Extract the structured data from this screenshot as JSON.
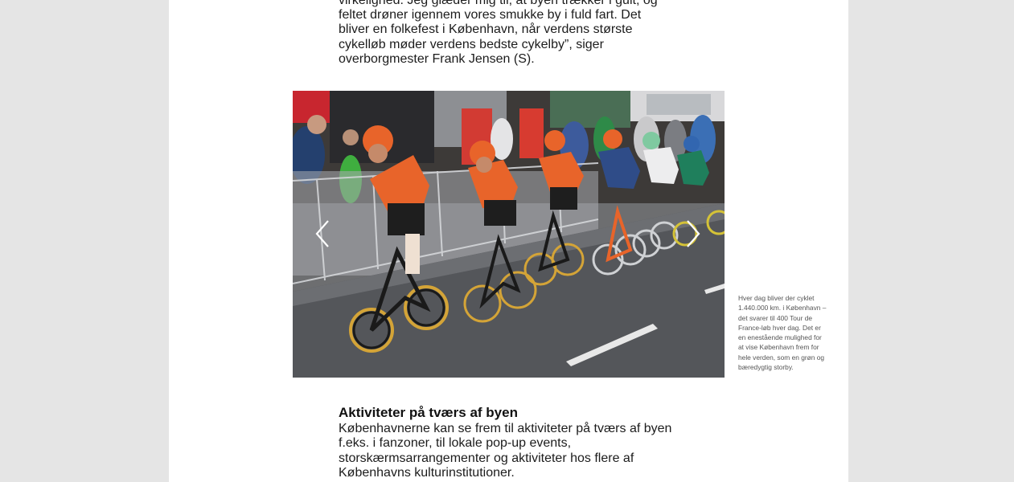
{
  "intro": {
    "lines": [
      "virkelighed. Jeg glæder mig til, at byen trækker i gult, og",
      "feltet drøner igennem vores smukke by i fuld fart. Det",
      "bliver en folkefest i København, når verdens største",
      "cykelløb møder verdens bedste cykelby”, siger",
      "overborgmester Frank Jensen (S)."
    ]
  },
  "gallery": {
    "prev_icon": "chevron-left-icon",
    "next_icon": "chevron-right-icon",
    "photo": "cyclists-racing-photo"
  },
  "caption": {
    "lines": [
      "Hver dag bliver der cyklet",
      "1.440.000 km. i København –",
      "det svarer til 400 Tour de",
      "France-løb hver dag. Det er",
      "en enestående mulighed for",
      "at vise København frem for",
      "hele verden, som en grøn og",
      "bæredygtig storby."
    ]
  },
  "section": {
    "title": "Aktiviteter på tværs af byen",
    "lines": [
      "Københavnerne kan se frem til aktiviteter på tværs af byen",
      "f.eks. i fanzoner, til lokale pop-up events,",
      "storskærmsarrangementer og aktiviteter hos flere af",
      "Københavns kulturinstitutioner."
    ]
  },
  "colors": {
    "background": "#e5e5e5",
    "page": "#ffffff",
    "jersey_orange": "#e8642a",
    "text": "#1c1c1c"
  }
}
